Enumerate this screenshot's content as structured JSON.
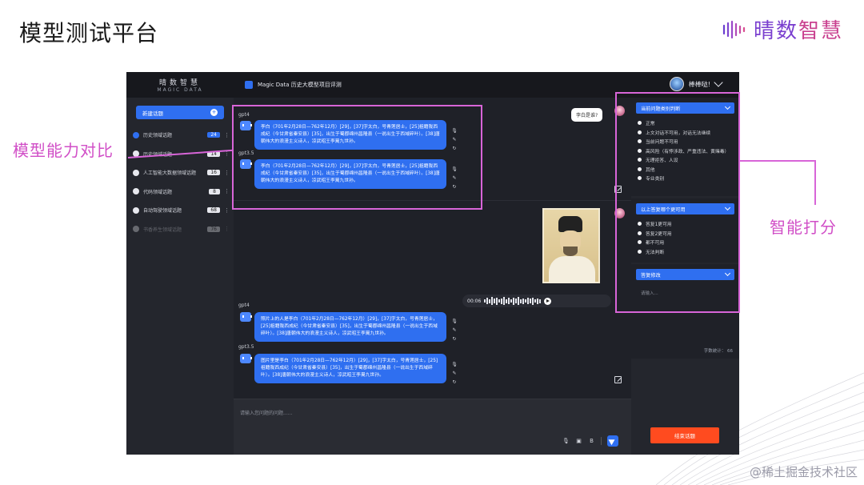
{
  "slide": {
    "title": "模型测试平台",
    "brand": {
      "part1": "晴数",
      "part2": "智慧"
    },
    "watermark": "@稀土掘金技术社区"
  },
  "app": {
    "logo_cn": "晴数智慧",
    "logo_en": "MAGIC DATA",
    "project_title": "Magic Data 历史大模型项目评测",
    "user_name": "棒棒哒!",
    "new_topic_label": "新建话题",
    "sidebar_items": [
      {
        "num": "6",
        "label": "历史领域话题",
        "count": "24",
        "active": true
      },
      {
        "num": "5",
        "label": "历史领域话题",
        "count": "14",
        "active": false
      },
      {
        "num": "4",
        "label": "人工智能大数据领域话题",
        "count": "16",
        "active": false
      },
      {
        "num": "3",
        "label": "代码领域话题",
        "count": "8",
        "active": false
      },
      {
        "num": "2",
        "label": "自动驾驶领域话题",
        "count": "68",
        "active": false
      },
      {
        "num": "1",
        "label": "书香养生领域话题",
        "count": "76",
        "active": false,
        "dim": true
      }
    ],
    "chat": {
      "q1": "李白是谁?",
      "q1_models": [
        {
          "label": "gpt4",
          "text": "李白（701年2月28日—762年12月）[29]，[37]字太白，号青莲居士，[25]祖籍陇西成纪（今甘肃省秦安县）[35]，出生于蜀郡绵州昌隆县（一说出生于西域碎叶）。[38]唐朝伟大的浪漫主义诗人，凉武昭王李暠九世孙。"
        },
        {
          "label": "gpt3.5",
          "text": "李白（701年2月28日—762年12月）[29]，[37]字太白，号青莲居士，[25]祖籍陇西成纪（今甘肃省秦安县）[35]，出生于蜀郡绵州昌隆县（一说出生于西域碎叶）。[38]唐朝伟大的浪漫主义诗人，凉武昭王李暠九世孙。"
        }
      ],
      "voice_time": "00:06",
      "q2_models": [
        {
          "label": "gpt4",
          "text": "照片上的人是李白（701年2月28日—762年12月）[29]，[37]字太白，号青莲居士，[25]祖籍陇西成纪（今甘肃省秦安县）[35]，出生于蜀郡绵州昌隆县（一说出生于西域碎叶）。[38]唐朝伟大的浪漫主义诗人，凉武昭王李暠九世孙。"
        },
        {
          "label": "gpt3.5",
          "text": "图片里是李白（701年2月28日—762年12月）[29]，[37]字太白，号青莲居士，[25]祖籍陇西成纪（今甘肃省秦安县）[35]，出生于蜀郡绵州昌隆县（一说出生于西域碎叶）。[38]唐朝伟大的浪漫主义诗人，凉武昭王李暠九世孙。"
        }
      ],
      "input_placeholder": "请输入您问题的问题......"
    },
    "panel": {
      "category_title": "当前问题类别判断",
      "category_options": [
        "正常",
        "上文对话不可用，对话无法继续",
        "当前问题不可用",
        "高风险（有悖涉政、严重违法、黄赌毒）",
        "无理拒答、人设",
        "其他",
        "专业类别"
      ],
      "better_title": "以上答复哪个更可用",
      "better_options": [
        "答复1更可用",
        "答复2更可用",
        "都不可用",
        "无法判断"
      ],
      "edit_title": "答复修改",
      "edit_placeholder": "请输入...",
      "word_count": "字数统计： 66",
      "end_button": "结束话题"
    }
  },
  "annotations": {
    "left": "模型能力对比",
    "right": "智能打分"
  },
  "colors": {
    "accent": "#2f6ff0",
    "highlight": "#d865d8",
    "end_button": "#ff4b1f"
  }
}
